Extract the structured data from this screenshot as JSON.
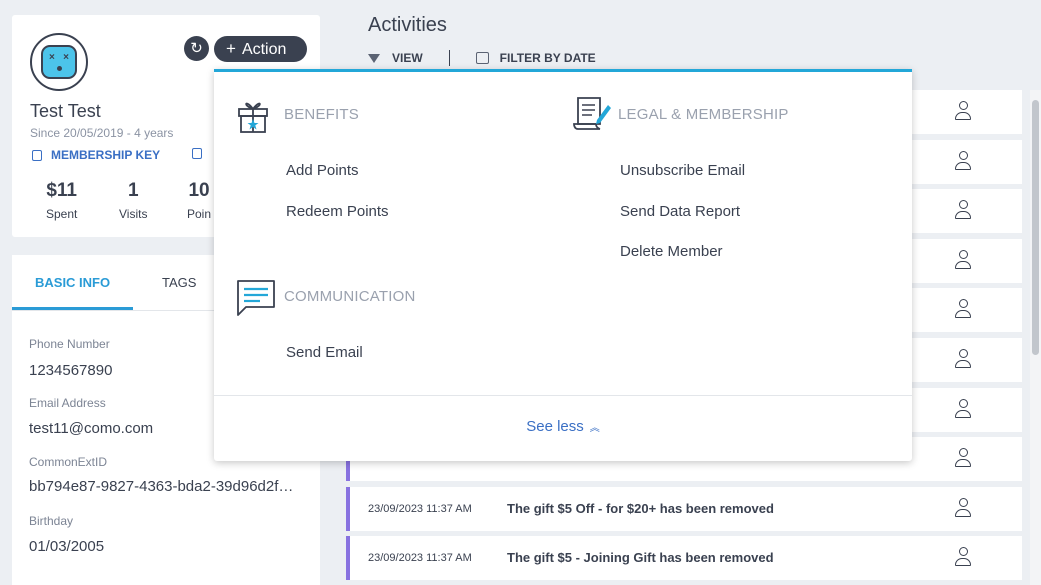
{
  "profile": {
    "name": "Test Test",
    "since": "Since 20/05/2019 - 4 years",
    "membership_key_label": "MEMBERSHIP KEY",
    "second_link_partial": "",
    "action_label": "Action",
    "refresh_icon": "refresh-icon",
    "stats": [
      {
        "value": "$11",
        "label": "Spent"
      },
      {
        "value": "1",
        "label": "Visits"
      },
      {
        "value": "10",
        "label": "Poin"
      }
    ]
  },
  "tabs": {
    "active": "BASIC INFO",
    "second": "TAGS"
  },
  "fields": [
    {
      "label": "Phone Number",
      "value": "1234567890"
    },
    {
      "label": "Email Address",
      "value": "test11@como.com"
    },
    {
      "label": "CommonExtID",
      "value": "bb794e87-9827-4363-bda2-39d96d2f…"
    },
    {
      "label": "Birthday",
      "value": "01/03/2005"
    }
  ],
  "activities": {
    "title": "Activities",
    "view_label": "VIEW",
    "filter_date_label": "FILTER BY DATE",
    "rows": [
      {
        "date": "",
        "msg": ""
      },
      {
        "date": "",
        "msg": ""
      },
      {
        "date": "",
        "msg": ""
      },
      {
        "date": "",
        "msg": ""
      },
      {
        "date": "",
        "msg": ""
      },
      {
        "date": "",
        "msg": ""
      },
      {
        "date": "",
        "msg": ""
      },
      {
        "date": "",
        "msg": ""
      },
      {
        "date": "23/09/2023 11:37 AM",
        "msg": "The gift $5 Off - for $20+ has been removed"
      },
      {
        "date": "23/09/2023 11:37 AM",
        "msg": "The gift $5 - Joining Gift has been removed"
      }
    ]
  },
  "dropdown": {
    "benefits": {
      "title": "BENEFITS",
      "items": [
        "Add Points",
        "Redeem Points"
      ]
    },
    "legal": {
      "title": "LEGAL & MEMBERSHIP",
      "items": [
        "Unsubscribe Email",
        "Send Data Report",
        "Delete Member"
      ]
    },
    "communication": {
      "title": "COMMUNICATION",
      "items": [
        "Send Email"
      ]
    },
    "see_less": "See less"
  },
  "colors": {
    "accent": "#23a7d8",
    "dark": "#3a4150",
    "link": "#3a6fc4",
    "row_border": "#8872e0"
  }
}
